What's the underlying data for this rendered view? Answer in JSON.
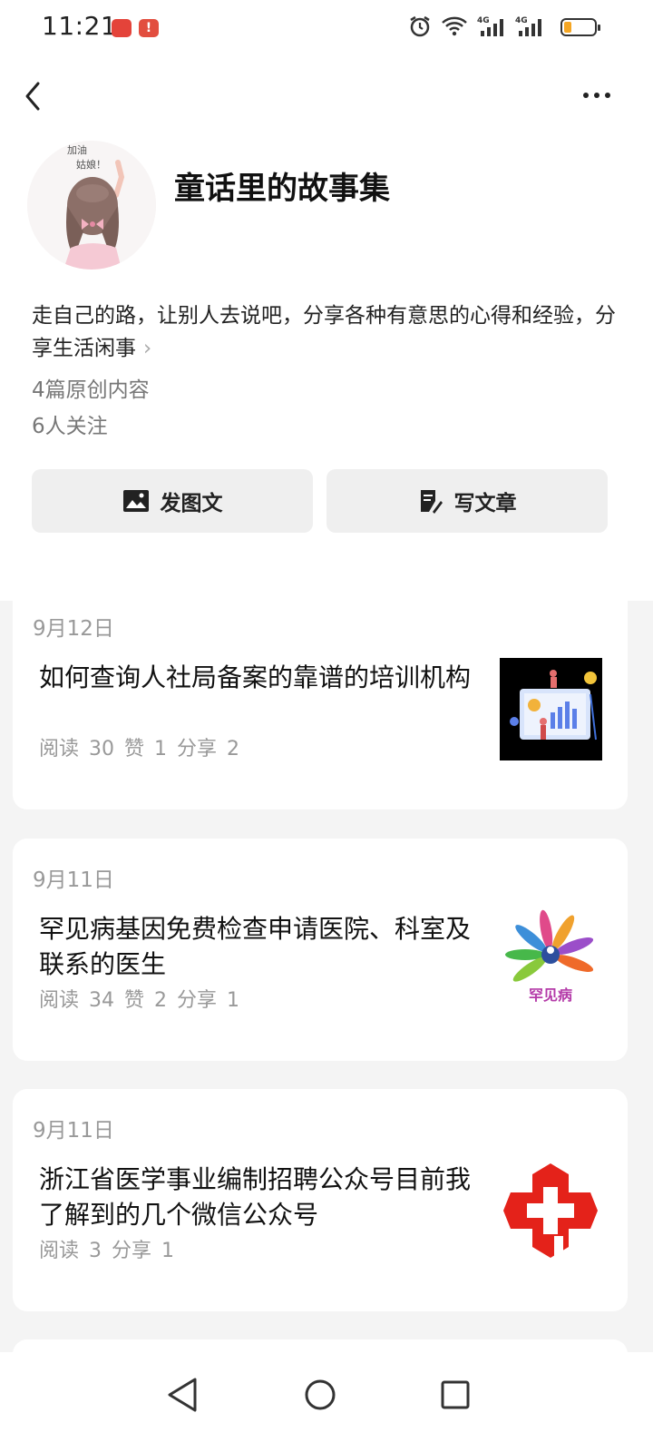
{
  "status_bar": {
    "time": "11:21"
  },
  "profile": {
    "name": "童话里的故事集",
    "bio": "走自己的路，让别人去说吧，分享各种有意思的心得和经验，分享生活闲事",
    "bio_more": "›",
    "original_count": "4篇原创内容",
    "followers": "6人关注"
  },
  "actions": {
    "post_image": "发图文",
    "write_article": "写文章"
  },
  "articles": [
    {
      "date": "9月12日",
      "title": "如何查询人社局备案的靠谱的培训机构",
      "meta": "阅读 30  赞 1  分享 2"
    },
    {
      "date": "9月11日",
      "title": "罕见病基因免费检查申请医院、科室及联系的医生",
      "meta": "阅读 34  赞 2  分享 1",
      "thumb_text": "罕见病"
    },
    {
      "date": "9月11日",
      "title": "浙江省医学事业编制招聘公众号目前我了解到的几个微信公众号",
      "meta": "阅读 3  分享 1"
    }
  ],
  "icons": [
    "back-icon",
    "more-icon",
    "image-icon",
    "edit-icon",
    "nav-back-icon",
    "nav-home-icon",
    "nav-recents-icon"
  ],
  "colors": {
    "accent_red": "#e4221a",
    "battery": "#f5a623"
  }
}
